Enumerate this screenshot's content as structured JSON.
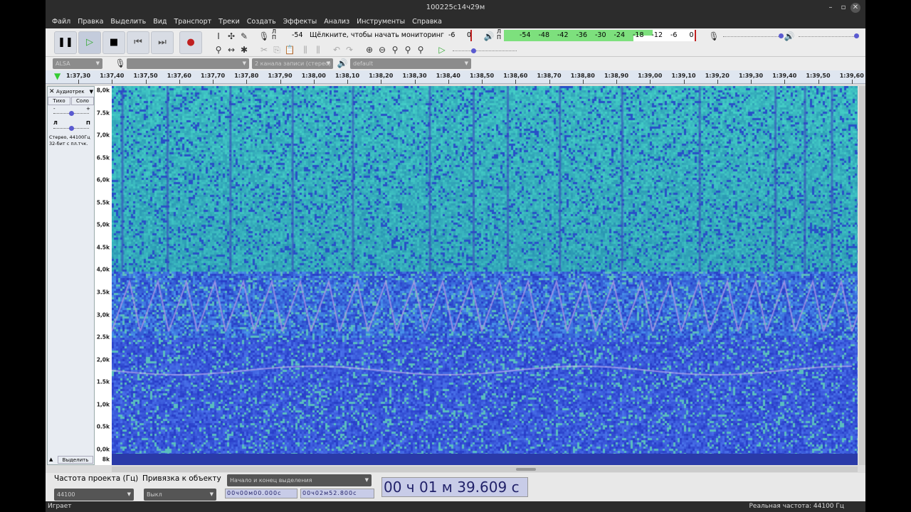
{
  "window": {
    "title": "100225с14ч29м"
  },
  "menu": [
    "Файл",
    "Правка",
    "Выделить",
    "Вид",
    "Транспорт",
    "Треки",
    "Создать",
    "Эффекты",
    "Анализ",
    "Инструменты",
    "Справка"
  ],
  "transport": {
    "pause": "❚❚",
    "play": "▷",
    "stop": "■",
    "skip_start": "⏮",
    "skip_end": "⏭",
    "record": "●"
  },
  "record_meter": {
    "lr": "Л\nП",
    "db": "-54",
    "hint": "Щёлкните, чтобы начать мониторинг",
    "m6": "-6",
    "zero": "0"
  },
  "play_meter": {
    "ticks": [
      "-54",
      "-48",
      "-42",
      "-36",
      "-30",
      "-24",
      "-18",
      "-12",
      "-6",
      "0"
    ],
    "level_l": 0.78,
    "level_r": 0.68
  },
  "devices": {
    "host": "ALSA",
    "rec_device": "",
    "channels": "2 канала записи (стерео)",
    "play_device": "default"
  },
  "ruler": {
    "labels": [
      "1:37,30",
      "1:37,40",
      "1:37,50",
      "1:37,60",
      "1:37,70",
      "1:37,80",
      "1:37,90",
      "1:38,00",
      "1:38,10",
      "1:38,20",
      "1:38,30",
      "1:38,40",
      "1:38,50",
      "1:38,60",
      "1:38,70",
      "1:38,80",
      "1:38,90",
      "1:39,00",
      "1:39,10",
      "1:39,20",
      "1:39,30",
      "1:39,40",
      "1:39,50",
      "1:39,60"
    ]
  },
  "track": {
    "name": "Аудиотрек",
    "mute": "Тихо",
    "solo": "Соло",
    "gain_minus": "-",
    "gain_plus": "+",
    "pan_l": "Л",
    "pan_r": "П",
    "info1": "Стерео, 44100Гц",
    "info2": "32-бит с пл.тчк.",
    "select": "Выделить",
    "gain": 0.5,
    "pan": 0.5
  },
  "freq_axis": {
    "labels": [
      "8,0k",
      "7.5k",
      "7,0k",
      "6.5k",
      "6,0k",
      "5.5k",
      "5,0k",
      "4.5k",
      "4,0k",
      "3.5k",
      "3,0k",
      "2.5k",
      "2,0k",
      "1.5k",
      "1,0k",
      "0.5k",
      "0,0k"
    ],
    "bottom_label": "8k"
  },
  "selection": {
    "rate_label": "Частота проекта (Гц)",
    "rate": "44100",
    "snap_label": "Привязка к объекту",
    "snap": "Выкл",
    "mode": "Начало и конец выделения",
    "start": "00ч00м00.000с",
    "end": "00ч02м52.800с",
    "position": "00 ч 01 м 39.609 с"
  },
  "status": {
    "left": "Играет",
    "right": "Реальная частота: 44100 Гц"
  }
}
